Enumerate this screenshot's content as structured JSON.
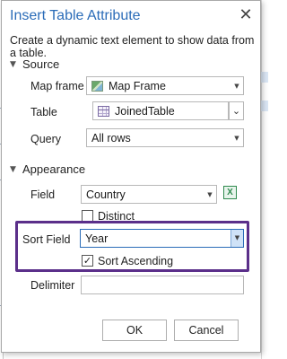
{
  "dialog": {
    "title": "Insert Table Attribute",
    "description": "Create a dynamic text element to show data from a table.",
    "close_symbol": "✕"
  },
  "source": {
    "header": "Source",
    "map_frame": {
      "label": "Map frame",
      "value": "Map Frame",
      "icon": "map-frame-icon"
    },
    "table": {
      "label": "Table",
      "value": "JoinedTable",
      "icon": "table-icon"
    },
    "query": {
      "label": "Query",
      "value": "All rows"
    }
  },
  "appearance": {
    "header": "Appearance",
    "field": {
      "label": "Field",
      "value": "Country",
      "icon": "field-calculator-icon"
    },
    "distinct": {
      "label": "Distinct",
      "checked": false
    },
    "sort_field": {
      "label": "Sort Field",
      "value": "Year"
    },
    "sort_ascending": {
      "label": "Sort Ascending",
      "checked": true
    },
    "delimiter": {
      "label": "Delimiter",
      "value": ""
    }
  },
  "buttons": {
    "ok": "OK",
    "cancel": "Cancel"
  },
  "colors": {
    "title": "#2b6cb8",
    "highlight_border": "#5b2f8a",
    "active_dropdown": "#2b6cb8"
  }
}
